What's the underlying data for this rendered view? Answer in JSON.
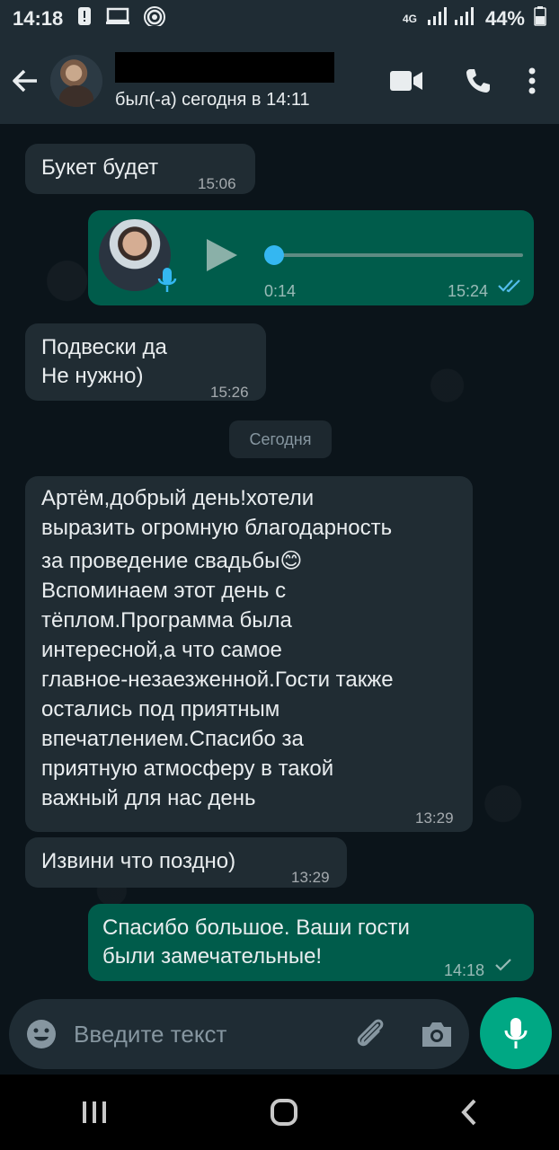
{
  "status_bar": {
    "time": "14:18",
    "network": "4G",
    "battery": "44%"
  },
  "header": {
    "last_seen": "был(-а) сегодня в 14:11",
    "icons": [
      "back-arrow-icon",
      "video-call-icon",
      "voice-call-icon",
      "more-options-icon"
    ]
  },
  "messages": [
    {
      "direction": "in",
      "text": "Букет будет",
      "time": "15:06"
    },
    {
      "direction": "out",
      "type": "voice",
      "duration": "0:14",
      "time": "15:24",
      "status": "read"
    },
    {
      "direction": "in",
      "lines": [
        "Подвески да",
        "Не нужно)"
      ],
      "time": "15:26"
    },
    {
      "direction": "date",
      "text": "Сегодня"
    },
    {
      "direction": "in",
      "lines": [
        "Артём,добрый день!хотели",
        "выразить огромную благодарность",
        "за проведение свадьбы😊",
        "Вспоминаем этот день с",
        "тёплом.Программа была",
        "интересной,а что самое",
        "главное-незаезженной.Гости также",
        "остались под приятным",
        "впечатлением.Спасибо за",
        "приятную атмосферу в такой",
        "важный для нас день"
      ],
      "time": "13:29"
    },
    {
      "direction": "in",
      "text": "Извини что поздно)",
      "time": "13:29"
    },
    {
      "direction": "out",
      "lines": [
        "Спасибо большое. Ваши гости",
        "были замечательные!"
      ],
      "time": "14:18",
      "status": "sent"
    }
  ],
  "composer": {
    "placeholder": "Введите текст"
  },
  "colors": {
    "incoming_bubble": "#202c33",
    "outgoing_bubble": "#005c4b",
    "accent": "#00a884",
    "read_tick": "#53bdeb"
  }
}
